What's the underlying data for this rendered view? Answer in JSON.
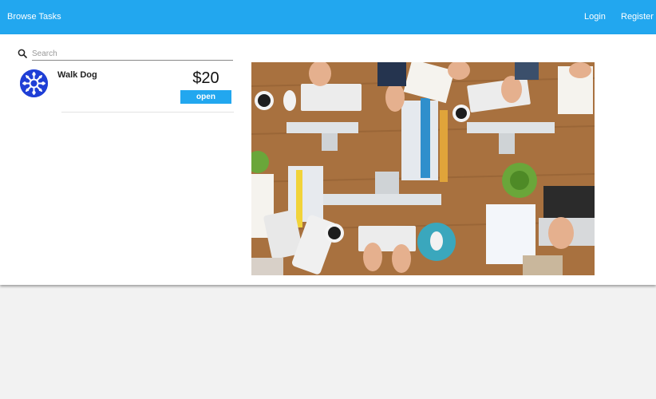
{
  "header": {
    "brand": "Browse Tasks",
    "login": "Login",
    "register": "Register",
    "color": "#22a7ef"
  },
  "search": {
    "placeholder": "Search",
    "value": ""
  },
  "tasks": [
    {
      "title": "Walk Dog",
      "price": "$20",
      "status": "open",
      "avatar_icon": "snowflake-pattern-icon",
      "avatar_color": "#1f3fd6"
    }
  ],
  "hero": {
    "icon": "office-desk-photo"
  }
}
